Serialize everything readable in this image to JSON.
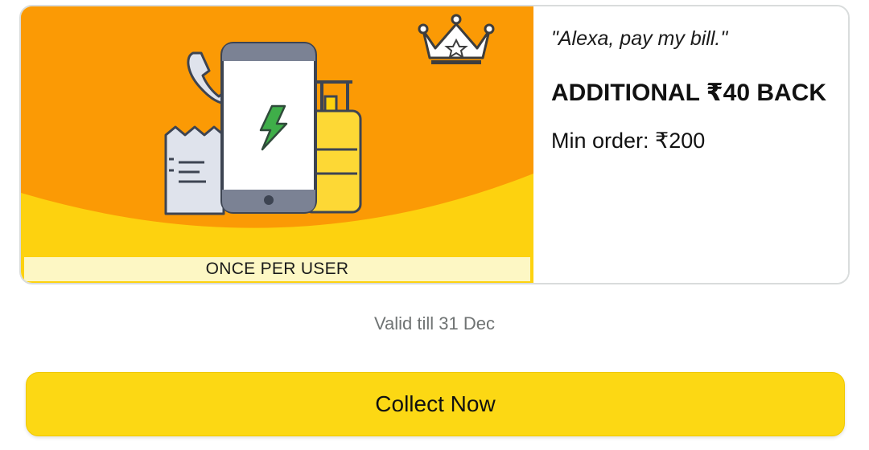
{
  "offer": {
    "banner_tag": "ONCE PER USER",
    "quote": "\"Alexa, pay my bill.\"",
    "headline": "ADDITIONAL ₹40 BACK",
    "min_order": "Min order: ₹200",
    "illustration_icons": [
      "crown-icon",
      "phone-handset-icon",
      "receipt-icon",
      "smartphone-icon",
      "lightning-icon",
      "suitcase-icon"
    ]
  },
  "validity": "Valid till 31 Dec",
  "action": {
    "collect_label": "Collect Now"
  },
  "colors": {
    "banner_orange": "#fb9a05",
    "banner_yellow": "#fdd20f",
    "strip": "#fdf7c4",
    "button": "#fcd814",
    "lightning": "#3fae49"
  }
}
